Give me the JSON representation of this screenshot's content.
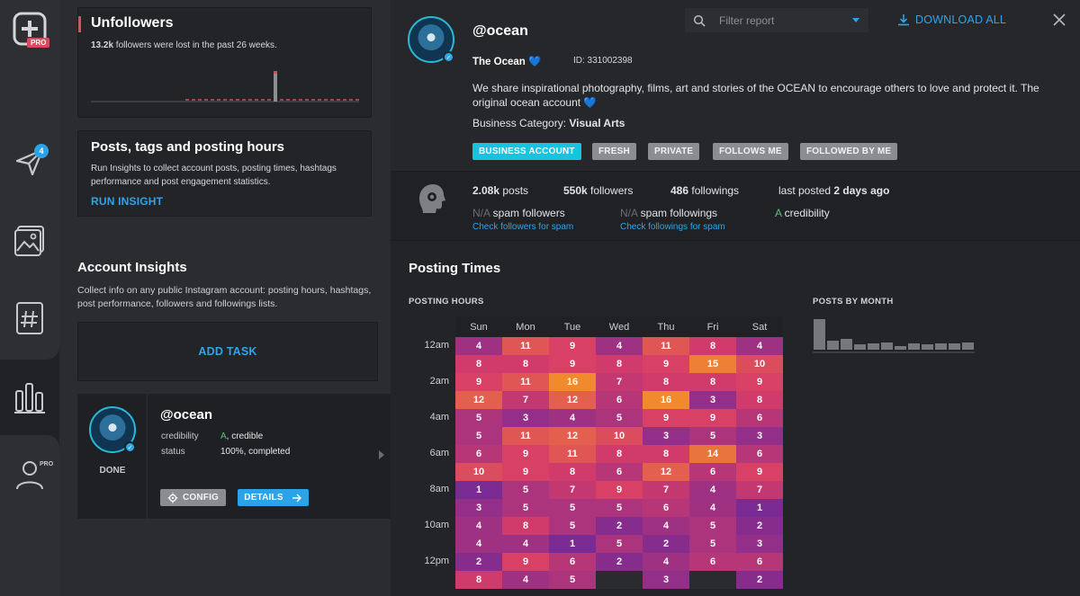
{
  "rail": {
    "pro": "PRO",
    "notification_count": "4",
    "profile_pro": "PRO"
  },
  "unfollowers": {
    "title": "Unfollowers",
    "count": "13.2k",
    "text": " followers were lost in the past 26 weeks."
  },
  "posts_card": {
    "title": "Posts, tags and posting hours",
    "desc": "Run Insights to collect account posts, posting times, hashtags performance and post engagement statistics.",
    "link": "RUN INSIGHT"
  },
  "insights": {
    "title": "Account Insights",
    "desc": "Collect info on any public Instagram account: posting hours, hashtags, post performance, followers and followings lists.",
    "add_task": "ADD TASK"
  },
  "task": {
    "handle": "@ocean",
    "status_label": "DONE",
    "cred_label": "credibility",
    "cred_grade": "A",
    "cred_text": ", credible",
    "status_key": "status",
    "status_value": "100%, completed",
    "config": "CONFIG",
    "details": "DETAILS"
  },
  "toolbar": {
    "filter_placeholder": "Filter report",
    "download": "DOWNLOAD ALL"
  },
  "profile": {
    "handle": "@ocean",
    "name": "The Ocean",
    "heart": "💙",
    "id": "ID: 331002398",
    "bio": "We share inspirational photography, films, art and stories of the OCEAN to encourage others to love and protect it. The original ocean account 💙",
    "category_label": "Business Category: ",
    "category": "Visual Arts",
    "tags": [
      "BUSINESS ACCOUNT",
      "FRESH",
      "PRIVATE",
      "FOLLOWS ME",
      "FOLLOWED BY ME"
    ]
  },
  "stats": {
    "posts_val": "2.08k",
    "posts_label": " posts",
    "followers_val": "550k",
    "followers_label": " followers",
    "followings_val": "486",
    "followings_label": " followings",
    "last_label": "last posted ",
    "last_val": "2 days ago",
    "spam_followers_val": "N/A",
    "spam_followers_label": " spam followers",
    "spam_followings_val": "N/A",
    "spam_followings_label": " spam followings",
    "cred_val": "A",
    "cred_label": " credibility",
    "check_followers": "Check followers for spam",
    "check_followings": "Check followings for spam"
  },
  "posting": {
    "title": "Posting Times",
    "hours_title": "POSTING HOURS",
    "month_title": "POSTS BY MONTH",
    "days": [
      "Sun",
      "Mon",
      "Tue",
      "Wed",
      "Thu",
      "Fri",
      "Sat"
    ],
    "hour_labels": [
      "12am",
      "2am",
      "4am",
      "6am",
      "8am",
      "10am",
      "12pm"
    ],
    "rows": [
      [
        "4",
        "11",
        "9",
        "4",
        "11",
        "8",
        "4"
      ],
      [
        "8",
        "8",
        "9",
        "8",
        "9",
        "15",
        "10"
      ],
      [
        "9",
        "11",
        "16",
        "7",
        "8",
        "8",
        "9"
      ],
      [
        "12",
        "7",
        "12",
        "6",
        "16",
        "3",
        "8"
      ],
      [
        "5",
        "3",
        "4",
        "5",
        "9",
        "9",
        "6"
      ],
      [
        "5",
        "11",
        "12",
        "10",
        "3",
        "5",
        "3"
      ],
      [
        "6",
        "9",
        "11",
        "8",
        "8",
        "14",
        "6"
      ],
      [
        "10",
        "9",
        "8",
        "6",
        "12",
        "6",
        "9"
      ],
      [
        "1",
        "5",
        "7",
        "9",
        "7",
        "4",
        "7"
      ],
      [
        "3",
        "5",
        "5",
        "5",
        "6",
        "4",
        "1"
      ],
      [
        "4",
        "8",
        "5",
        "2",
        "4",
        "5",
        "2"
      ],
      [
        "4",
        "4",
        "1",
        "5",
        "2",
        "5",
        "3"
      ],
      [
        "2",
        "9",
        "6",
        "2",
        "4",
        "6",
        "6"
      ],
      [
        "8",
        "4",
        "5",
        "",
        "3",
        "",
        "2"
      ]
    ]
  },
  "colors": {
    "accent": "#2fa4ea",
    "business_tag": "#17c3de",
    "unfollower_bar": "#e04d5e",
    "heat_low": "#7a2a93",
    "heat_high": "#f08a2c",
    "credibility_grade": "#5cc07a"
  },
  "icons": [
    "plus-logo-icon",
    "send-icon",
    "image-icon",
    "hashtag-icon",
    "chart-bars-icon",
    "user-icon",
    "search-icon",
    "caret-down-icon",
    "download-icon",
    "close-icon",
    "gear-icon",
    "arrow-right-icon",
    "head-silhouette-icon",
    "chevron-right-icon"
  ]
}
